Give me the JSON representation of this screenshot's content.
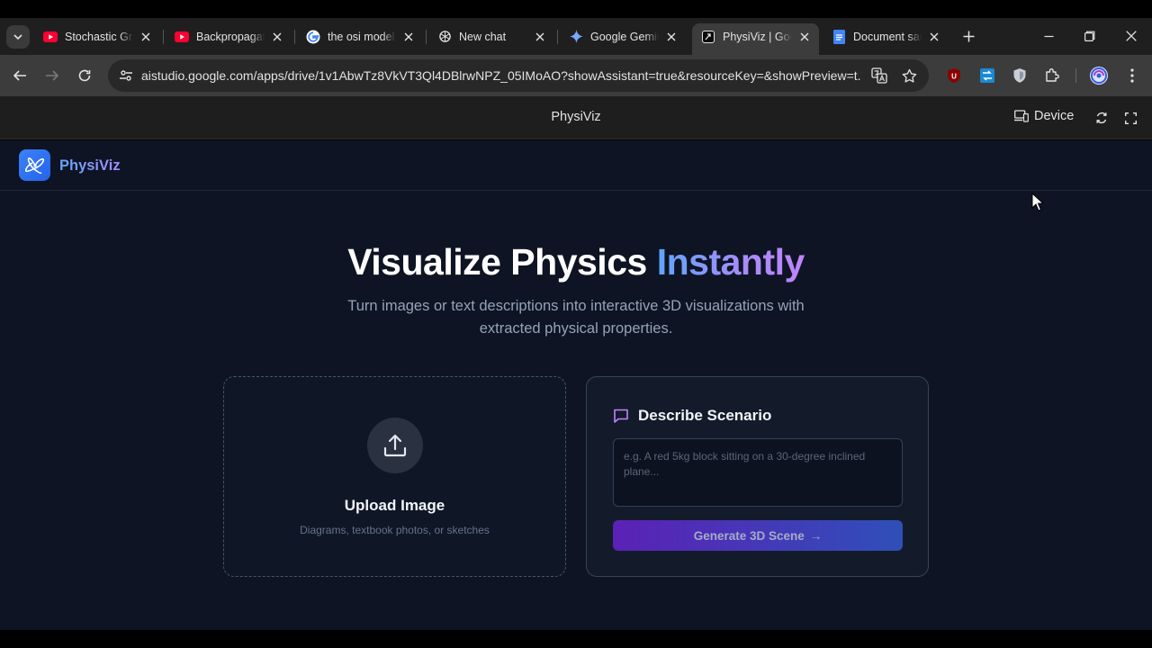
{
  "browser": {
    "tabs": [
      {
        "title": "Stochastic Gra",
        "icon": "youtube-icon",
        "active": false
      },
      {
        "title": "Backpropagat",
        "icon": "youtube-icon",
        "active": false
      },
      {
        "title": "the osi model",
        "icon": "google-icon",
        "active": false
      },
      {
        "title": "New chat",
        "icon": "openai-icon",
        "active": false
      },
      {
        "title": "Google Gemini",
        "icon": "gemini-icon",
        "active": false
      },
      {
        "title": "PhysiViz | Google AI Studio",
        "icon": "aistudio-icon",
        "active": true
      },
      {
        "title": "Document sans titre",
        "icon": "docs-icon",
        "active": false
      }
    ],
    "url": "aistudio.google.com/apps/drive/1v1AbwTz8VkVT3Ql4DBlrwNPZ_05IMoAO?showAssistant=true&resourceKey=&showPreview=t...",
    "colors": {
      "accent": "#a78bfa",
      "brand_blue": "#3b82f6"
    }
  },
  "studio": {
    "app_title": "PhysiViz",
    "device_label": "Device"
  },
  "app": {
    "brand": "PhysiViz",
    "hero": {
      "title_main": "Visualize Physics ",
      "title_highlight": "Instantly",
      "subtitle": "Turn images or text descriptions into interactive 3D visualizations with extracted physical properties."
    },
    "upload": {
      "title": "Upload Image",
      "subtitle": "Diagrams, textbook photos, or sketches"
    },
    "describe": {
      "title": "Describe Scenario",
      "value": "",
      "placeholder": "e.g. A red 5kg block sitting on a 30-degree inclined plane...",
      "button_label": "Generate 3D Scene",
      "button_arrow": "→"
    }
  }
}
